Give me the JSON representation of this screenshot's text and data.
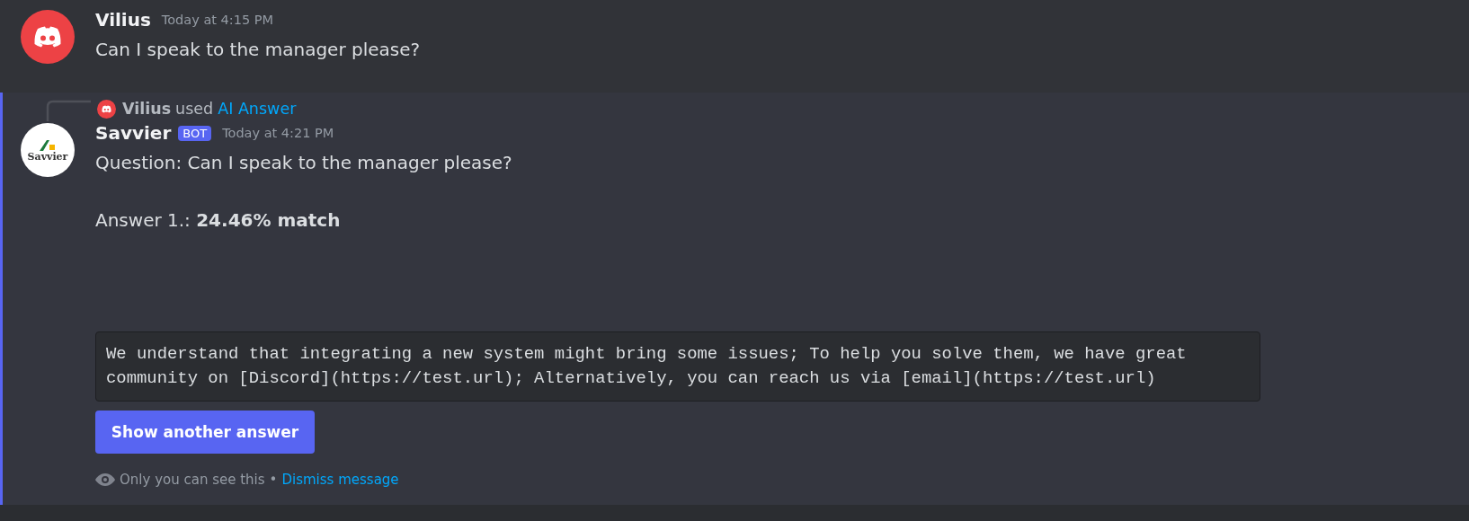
{
  "messages": [
    {
      "kind": "discord",
      "author": "Vilius",
      "timestamp": "Today at 4:15 PM",
      "lines": [
        "Can I speak to the manager please?"
      ]
    },
    {
      "kind": "savvier",
      "avatar_text": "Savvier",
      "author": "Savvier",
      "badge": "BOT",
      "timestamp": "Today at 4:21 PM",
      "highlighted": true,
      "reply": {
        "user": "Vilius",
        "verb": "used",
        "command": "AI Answer"
      },
      "lines": [
        "Question: Can I speak to the manager please?",
        "Answer 1.: **24.46% match**"
      ],
      "code": "We understand that integrating a new system might bring some issues; To help you solve them, we have great community on [Discord](https://test.url); Alternatively, you can reach us via [email](https://test.url)",
      "button": "Show another answer",
      "footer": {
        "note": "Only you can see this",
        "separator": "•",
        "link": "Dismiss message"
      }
    }
  ]
}
